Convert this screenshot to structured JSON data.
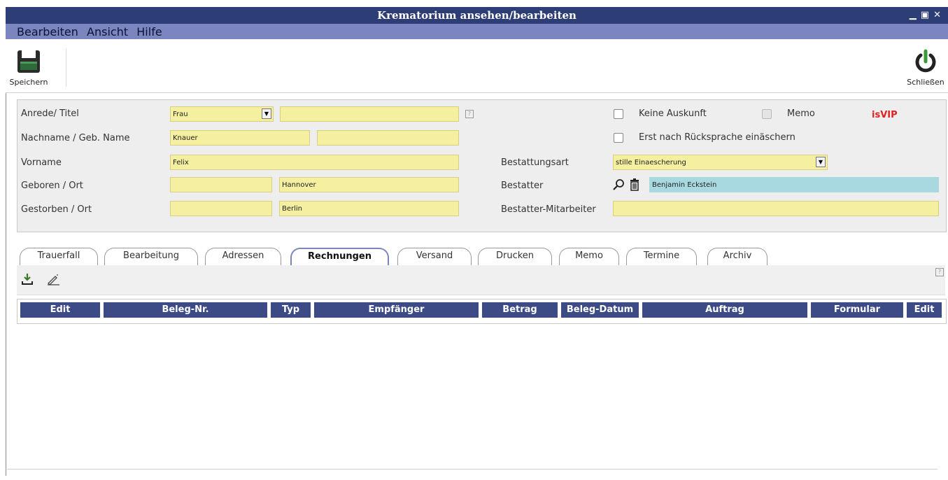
{
  "window": {
    "title": "Krematorium ansehen/bearbeiten"
  },
  "menu": {
    "items": [
      "Bearbeiten",
      "Ansicht",
      "Hilfe"
    ]
  },
  "toolbar": {
    "save_label": "Speichern",
    "close_label": "Schließen"
  },
  "form": {
    "anrede_label": "Anrede/ Titel",
    "anrede_value": "Frau",
    "titel_value": "",
    "nachname_label": "Nachname / Geb. Name",
    "nachname_value": "Knauer",
    "geb_name_value": "",
    "vorname_label": "Vorname",
    "vorname_value": "Felix",
    "geboren_label": "Geboren / Ort",
    "geboren_date": "",
    "geboren_ort": "Hannover",
    "gestorben_label": "Gestorben / Ort",
    "gestorben_date": "",
    "gestorben_ort": "Berlin",
    "keine_auskunft_label": "Keine Auskunft",
    "keine_auskunft_checked": false,
    "memo_label": "Memo",
    "memo_checked": false,
    "vip_label": "isVIP",
    "erst_label": "Erst nach Rücksprache einäschern",
    "erst_checked": false,
    "bestattungsart_label": "Bestattungsart",
    "bestattungsart_value": "stille Einaescherung",
    "bestatter_label": "Bestatter",
    "bestatter_value": "Benjamin Eckstein",
    "mitarbeiter_label": "Bestatter-Mitarbeiter",
    "mitarbeiter_value": ""
  },
  "tabs": [
    "Trauerfall",
    "Bearbeitung",
    "Adressen",
    "Rechnungen",
    "Versand",
    "Drucken",
    "Memo",
    "Termine",
    "Archiv"
  ],
  "active_tab": "Rechnungen",
  "grid": {
    "columns": [
      "Edit",
      "Beleg-Nr.",
      "Typ",
      "Empfänger",
      "Betrag",
      "Beleg-Datum",
      "Auftrag",
      "Formular",
      "Edit"
    ]
  },
  "colors": {
    "titlebar": "#2c3e75",
    "menubar": "#7b86c0",
    "field": "#f4f0a0",
    "vip": "#e02020",
    "grid_header": "#3c4a86"
  }
}
